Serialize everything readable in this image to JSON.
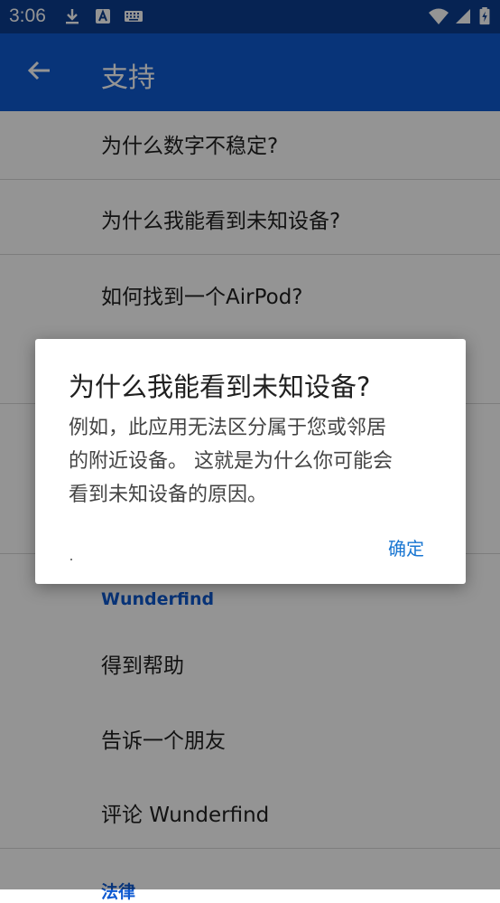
{
  "status_bar": {
    "time": "3:06"
  },
  "app_bar": {
    "title": "支持"
  },
  "list": {
    "items": [
      "为什么数字不稳定?",
      "为什么我能看到未知设备?",
      "如何找到一个AirPod?"
    ],
    "section_wunderfind": "Wunderfind",
    "wunderfind_items": [
      "得到帮助",
      "告诉一个朋友",
      "评论 Wunderfind"
    ],
    "section_legal": "法律"
  },
  "dialog": {
    "title": "为什么我能看到未知设备?",
    "body_lines": [
      "例如，此应用无法区分属于您或邻居",
      "的附近设备。 这就是为什么你可能会",
      "看到未知设备的原因。"
    ],
    "ok_label": "确定"
  },
  "colors": {
    "app_bar": "#0f5ad1",
    "status_bar": "#0b3d8f",
    "accent": "#1976d2"
  }
}
